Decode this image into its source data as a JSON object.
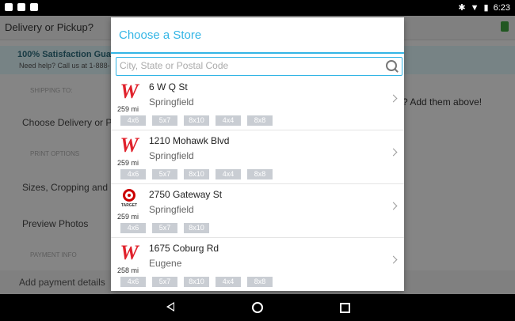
{
  "status": {
    "time": "6:23"
  },
  "background": {
    "title": "Delivery or Pickup?",
    "banner_title": "100% Satisfaction Gua",
    "banner_sub": "Need help? Call us at 1-888-",
    "rows": [
      "SHIPPING TO:",
      "Choose Delivery or P",
      "PRINT OPTIONS",
      "Sizes, Cropping and",
      "Preview Photos",
      "PAYMENT INFO"
    ],
    "right_text": "? Add them above!",
    "payment": "Add payment details"
  },
  "dialog": {
    "title": "Choose a Store",
    "search_placeholder": "City, State or Postal Code",
    "stores": [
      {
        "logo": "W",
        "brand": "walgreens",
        "distance": "259 mi",
        "address": "6 W Q St",
        "city": "Springfield",
        "sizes": [
          "4x6",
          "5x7",
          "8x10",
          "4x4",
          "8x8"
        ]
      },
      {
        "logo": "W",
        "brand": "walgreens",
        "distance": "259 mi",
        "address": "1210 Mohawk Blvd",
        "city": "Springfield",
        "sizes": [
          "4x6",
          "5x7",
          "8x10",
          "4x4",
          "8x8"
        ]
      },
      {
        "logo": "TARGET",
        "brand": "target",
        "distance": "259 mi",
        "address": "2750 Gateway St",
        "city": "Springfield",
        "sizes": [
          "4x6",
          "5x7",
          "8x10"
        ]
      },
      {
        "logo": "W",
        "brand": "walgreens",
        "distance": "258 mi",
        "address": "1675 Coburg Rd",
        "city": "Eugene",
        "sizes": [
          "4x6",
          "5x7",
          "8x10",
          "4x4",
          "8x8"
        ]
      }
    ]
  },
  "colors": {
    "accent": "#33b5e5",
    "walgreens": "#e0212b",
    "target": "#cc0000",
    "chip": "#c9cdd3"
  },
  "icons": {
    "search": "search-icon",
    "chevron": "chevron-right-icon",
    "back": "back-icon",
    "home": "home-icon",
    "recents": "recents-icon"
  }
}
